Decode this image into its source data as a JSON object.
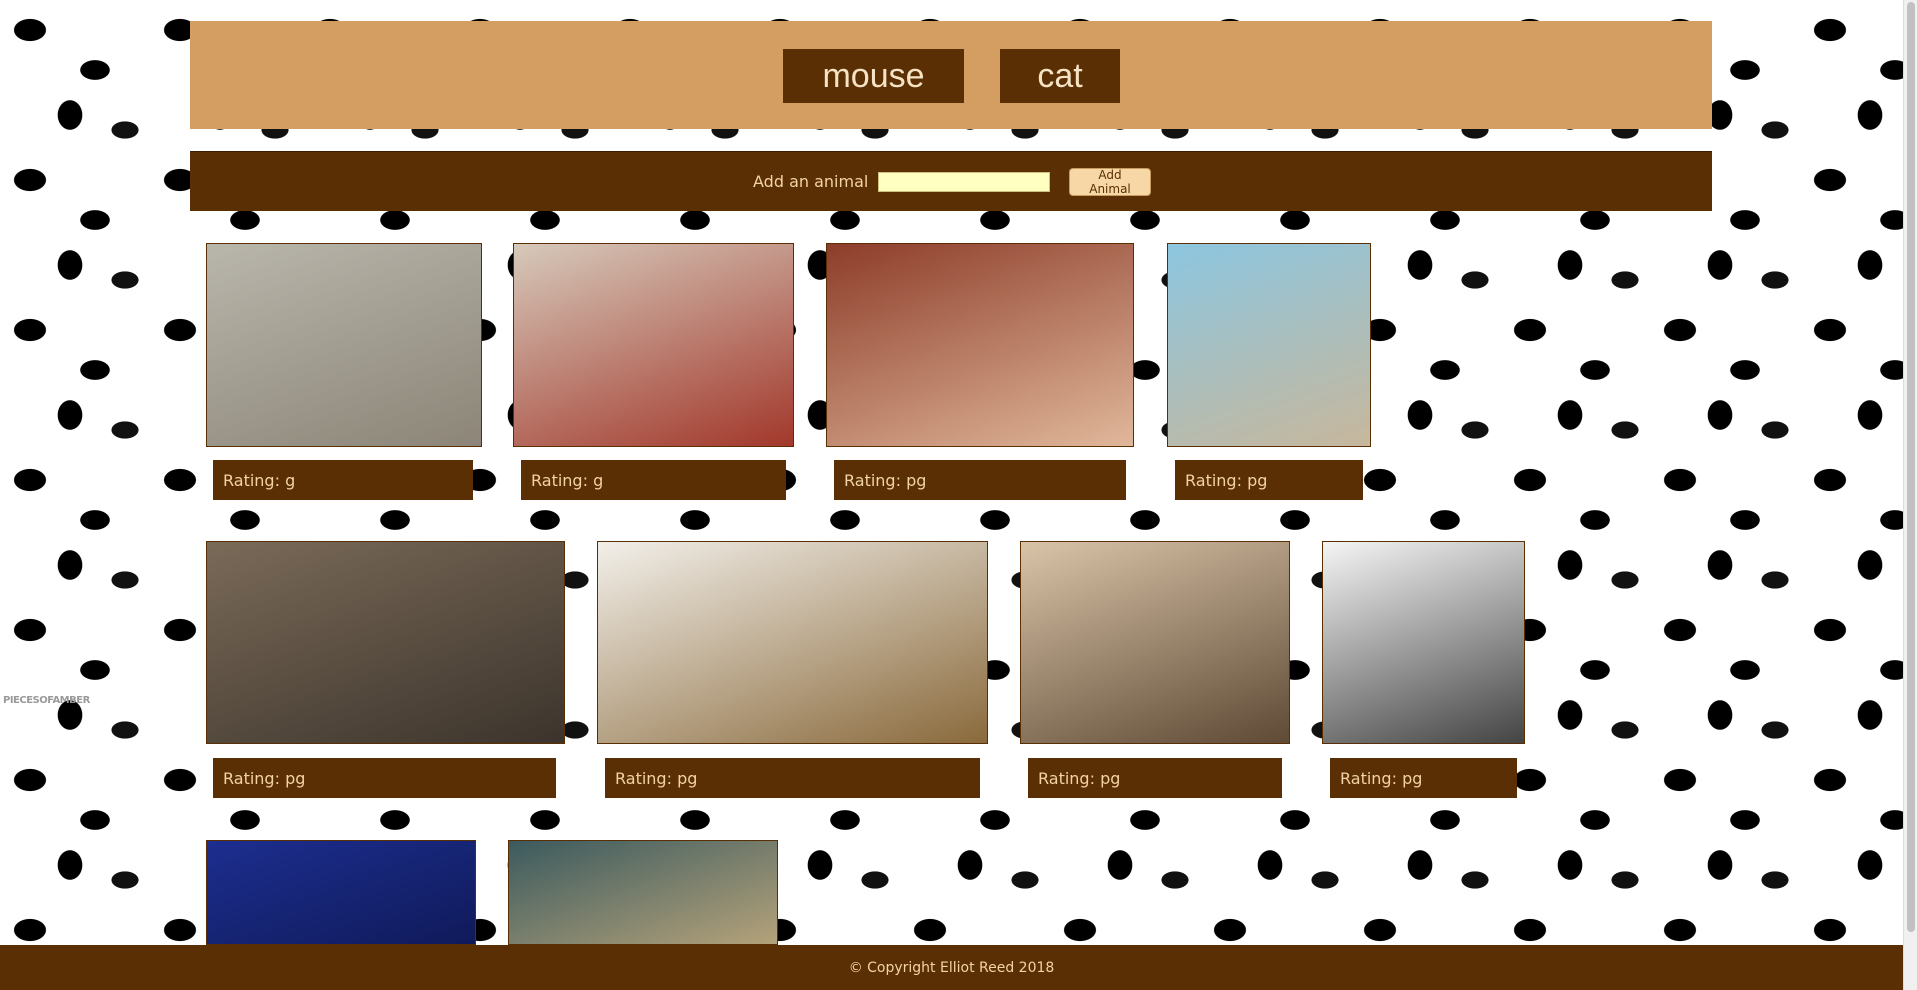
{
  "topics": [
    "mouse",
    "cat"
  ],
  "form": {
    "label": "Add an animal",
    "input_value": "",
    "button_label": "Add Animal"
  },
  "gifs": [
    {
      "rating": "Rating: g",
      "colors": [
        "#b9b6ab",
        "#8c8578"
      ]
    },
    {
      "rating": "Rating: g",
      "colors": [
        "#d6c9bb",
        "#a2382b"
      ]
    },
    {
      "rating": "Rating: pg",
      "colors": [
        "#8d3d2a",
        "#e0b79a"
      ]
    },
    {
      "rating": "Rating: pg",
      "colors": [
        "#8cc6e0",
        "#c7b79c"
      ]
    },
    {
      "rating": "Rating: pg",
      "colors": [
        "#7a6a58",
        "#3c342c"
      ]
    },
    {
      "rating": "Rating: pg",
      "colors": [
        "#f2efe9",
        "#8a6a3c"
      ]
    },
    {
      "rating": "Rating: pg",
      "colors": [
        "#d9c4a8",
        "#5e4a35"
      ]
    },
    {
      "rating": "Rating: pg",
      "colors": [
        "#f5f5f5",
        "#444444"
      ]
    },
    {
      "rating": "",
      "colors": [
        "#1c2e8f",
        "#101a5a"
      ]
    },
    {
      "rating": "",
      "colors": [
        "#3b5a5e",
        "#b4a27a"
      ]
    }
  ],
  "watermark": "PIECESOFAMBER",
  "footer": "© Copyright Elliot Reed 2018"
}
